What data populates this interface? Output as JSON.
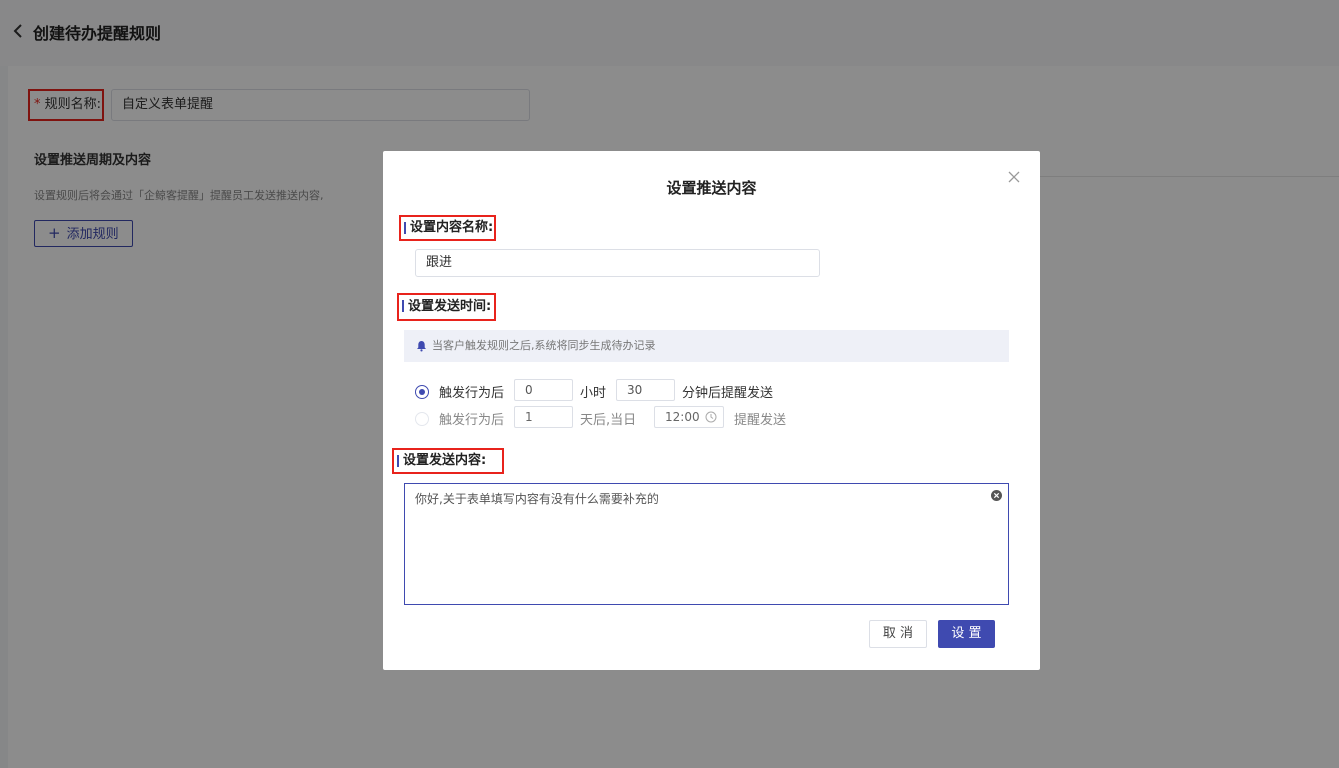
{
  "page": {
    "title": "创建待办提醒规则",
    "rule_name_required_mark": "*",
    "rule_name_label": " 规则名称:",
    "rule_name_value": "自定义表单提醒",
    "section_title": "设置推送周期及内容",
    "section_desc": "设置规则后将会通过「企鲸客提醒」提醒员工发送推送内容,",
    "add_rule_icon": "+",
    "add_rule_label": "添加规则"
  },
  "dialog": {
    "title": "设置推送内容",
    "content_name_label": "设置内容名称:",
    "content_name_value": "跟进",
    "send_time_label": "设置发送时间:",
    "notice_text": "当客户触发规则之后,系统将同步生成待办记录",
    "option1": {
      "prefix": "触发行为后",
      "hours": "0",
      "hours_unit": "小时",
      "minutes": "30",
      "suffix": "分钟后提醒发送",
      "selected": true
    },
    "option2": {
      "prefix": "触发行为后",
      "days": "1",
      "days_unit": "天后,当日",
      "time": "12:00",
      "suffix": "提醒发送",
      "selected": false
    },
    "send_content_label": "设置发送内容:",
    "send_content_value": "你好,关于表单填写内容有没有什么需要补充的",
    "cancel_label": "取 消",
    "confirm_label": "设 置"
  },
  "colors": {
    "accent": "#3f4ab0",
    "highlight": "#e8231c"
  },
  "icons": [
    "back-chevron-icon",
    "plus-icon",
    "close-icon",
    "bell-icon",
    "clock-icon",
    "clear-icon"
  ]
}
